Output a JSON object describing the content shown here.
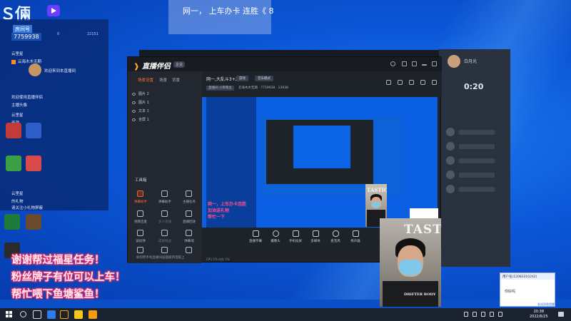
{
  "desktop": {
    "logo_text": "Ｓ倆",
    "banner_text": "网一，  上车办卡 连胜《 8"
  },
  "chat_panel": {
    "room_label": "房间号",
    "room_number": "7759938",
    "stat_fans": "0",
    "stat_online": "22151",
    "lines": [
      "云里星",
      "云海木木无期",
      "欢迎来到本直播间",
      "欢迎使用直播伴侣",
      "主播头像",
      "云里星",
      "来源",
      "云里星",
      "的礼物",
      "请关注小礼物屏蔽"
    ]
  },
  "app": {
    "logo": "直播伴侣",
    "version": "企业",
    "side_tabs": [
      "场景设置",
      "场景",
      "背景"
    ],
    "sources": [
      "图片 2",
      "图片 1",
      "文本 1",
      "全屏 1"
    ],
    "toolbox_label": "工具箱",
    "tools": [
      {
        "label": "弹幕助手",
        "hot": true
      },
      {
        "label": "弹幕助手",
        "hot": false
      },
      {
        "label": "主播任务",
        "hot": false
      },
      {
        "label": "视频连麦",
        "hot": false
      },
      {
        "label": "多人连线",
        "hot": false
      },
      {
        "label": "直播回放",
        "hot": false
      },
      {
        "label": "波段弹",
        "hot": false
      },
      {
        "label": "成就挑战",
        "hot": false
      },
      {
        "label": "弹幕墙",
        "hot": false
      },
      {
        "label": "小插件",
        "hot": false
      },
      {
        "label": "嗨趣",
        "hot": false
      },
      {
        "label": "更多",
        "hot": false
      }
    ],
    "side_footer": "如何把手机直播间画面搬到电脑上",
    "room_title": "网一,大乱斗3+2",
    "tag_game": "游戏",
    "tag_audio": "音乐模式",
    "room_meta_left": "直播间 小草莓主",
    "room_meta_right": "云海木木无期 · 7759938 · 13938",
    "controls": [
      "直播字幕",
      "摄像头",
      "手机投屏",
      "多媒体",
      "麦克风",
      "扬声器"
    ],
    "preview_text": [
      "网一，上车办卡连胜",
      "加油送礼物",
      "帮忙一下"
    ],
    "status_text": "CPU 5% 内存 5%"
  },
  "right_window": {
    "name": "白月光",
    "timer": "0:20"
  },
  "webcam": {
    "text_small": "TASTIC",
    "text_large": "TASTIC",
    "text_sub": "DRIFTER BODY"
  },
  "overlay": {
    "lines": [
      "谢谢帮过福星任务！",
      "粉丝牌子有位可以上车！",
      "帮忙喂下鱼塘鲨鱼！"
    ]
  },
  "popup": {
    "header": "用户名(12083310242)",
    "body": "你好吗",
    "link": "发送消息提醒"
  },
  "clock": {
    "time": "20:38",
    "date": "2022/6/25"
  },
  "colors": {
    "desktop": "#0b57d8",
    "accent": "#ff6a3d",
    "overlay_outline": "#e0306a"
  }
}
